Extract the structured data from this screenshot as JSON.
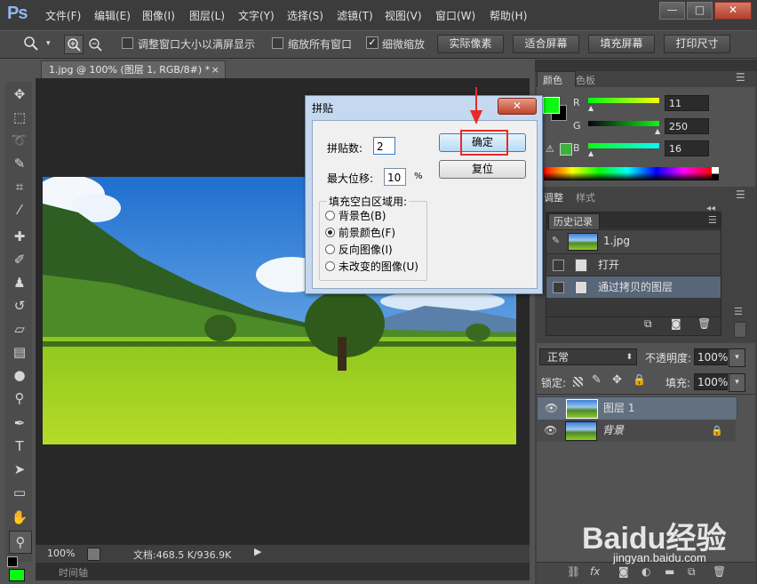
{
  "app": {
    "logo": "Ps"
  },
  "menu": [
    "文件(F)",
    "编辑(E)",
    "图像(I)",
    "图层(L)",
    "文字(Y)",
    "选择(S)",
    "滤镜(T)",
    "视图(V)",
    "窗口(W)",
    "帮助(H)"
  ],
  "window_buttons": {
    "minimize": "—",
    "maximize": "□",
    "close": "✕"
  },
  "options": {
    "resize_windows": "调整窗口大小以满屏显示",
    "zoom_all": "缩放所有窗口",
    "scrubby_zoom": "细微缩放",
    "buttons": [
      "实际像素",
      "适合屏幕",
      "填充屏幕",
      "打印尺寸"
    ]
  },
  "document": {
    "tab_title": "1.jpg @ 100% (图层 1, RGB/8#) *",
    "tab_close": "×"
  },
  "status": {
    "zoom": "100%",
    "doc_info": "文档:468.5 K/936.9K",
    "timeline": "时间轴"
  },
  "color_panel": {
    "tabs": [
      "颜色",
      "色板"
    ],
    "channels": [
      {
        "label": "R",
        "value": "11"
      },
      {
        "label": "G",
        "value": "250"
      },
      {
        "label": "B",
        "value": "16"
      }
    ],
    "foreground_color": "#0bfa10",
    "background_color": "#000000"
  },
  "adjust_panel": {
    "tabs": [
      "调整",
      "样式"
    ]
  },
  "history_panel": {
    "tab": "历史记录",
    "snapshot": "1.jpg",
    "items": [
      "打开",
      "通过拷贝的图层"
    ]
  },
  "layers_panel": {
    "blend_mode": "正常",
    "opacity_label": "不透明度:",
    "opacity_value": "100%",
    "lock_label": "锁定:",
    "fill_label": "填充:",
    "fill_value": "100%",
    "layers": [
      {
        "name": "图层 1",
        "selected": true
      },
      {
        "name": "背景",
        "selected": false
      }
    ]
  },
  "dialog": {
    "title": "拼贴",
    "tiles_label": "拼贴数:",
    "tiles_value": "2",
    "max_offset_label": "最大位移:",
    "max_offset_value": "10",
    "percent": "%",
    "ok_button": "确定",
    "reset_button": "复位",
    "fill_group_title": "填充空白区域用:",
    "fill_options": [
      "背景色(B)",
      "前景颜色(F)",
      "反向图像(I)",
      "未改变的图像(U)"
    ],
    "fill_selected": 1
  },
  "watermark": {
    "logo": "Baidu经验",
    "url": "jingyan.baidu.com"
  }
}
